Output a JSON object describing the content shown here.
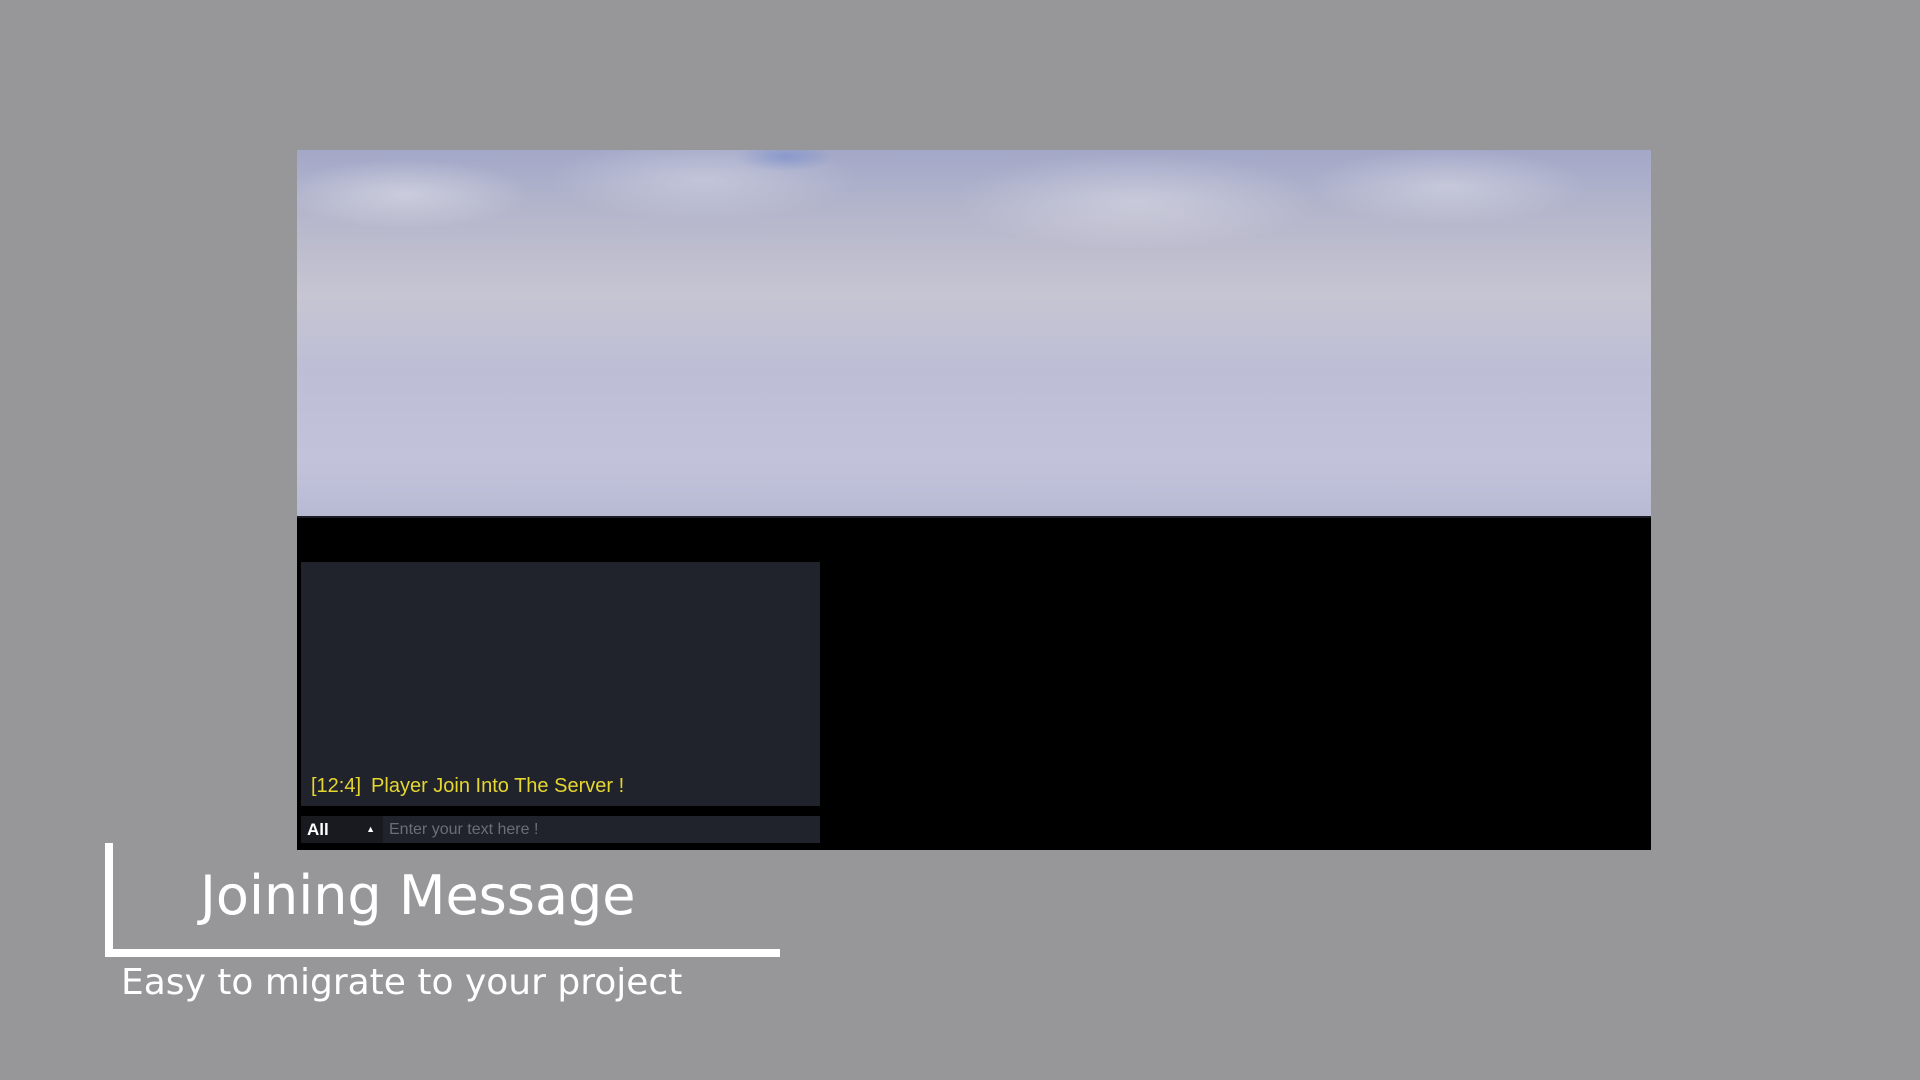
{
  "chat": {
    "messages": [
      {
        "timestamp": "[12:4]",
        "text": "Player Join Into The Server !",
        "color": "#e6d630"
      }
    ],
    "channel": {
      "selected": "All",
      "icon": "caret-up-icon"
    },
    "input": {
      "placeholder": "Enter your text here !",
      "value": ""
    }
  },
  "caption": {
    "title": "Joining Message",
    "subtitle": "Easy to migrate to your project"
  },
  "colors": {
    "background": "#979799",
    "chat_panel": "#20232b",
    "message_text": "#e6d630"
  }
}
